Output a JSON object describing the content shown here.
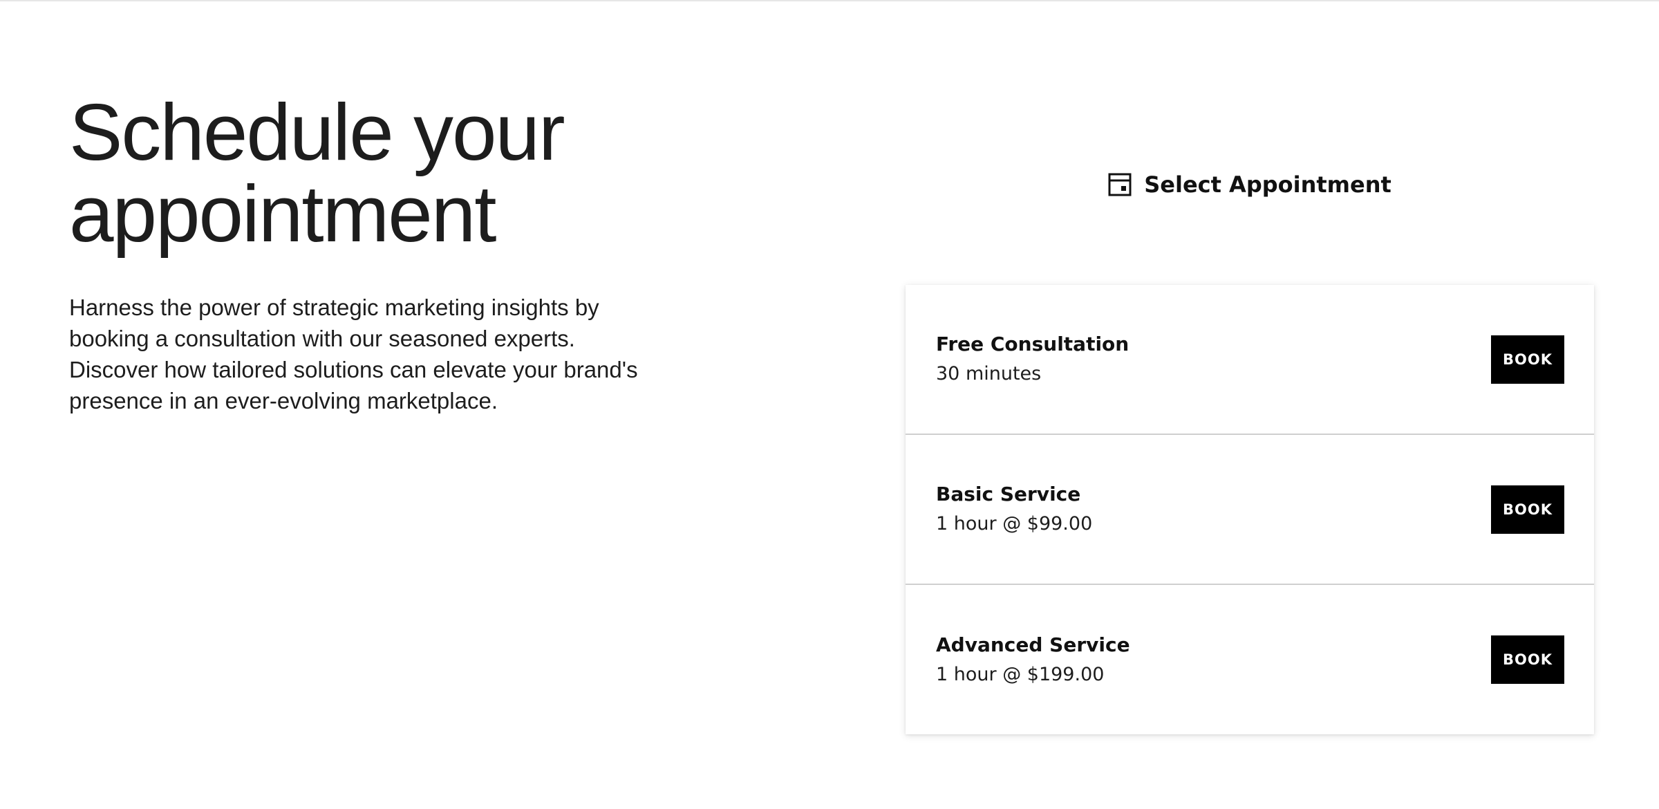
{
  "hero": {
    "title_line1": "Schedule your",
    "title_line2": "appointment",
    "description": "Harness the power of strategic marketing insights by booking a consultation with our seasoned experts. Discover how tailored solutions can elevate your brand's presence in an ever-evolving marketplace."
  },
  "booking": {
    "header_icon": "calendar-icon",
    "title": "Select Appointment",
    "services": [
      {
        "name": "Free Consultation",
        "detail": "30 minutes",
        "button_label": "BOOK"
      },
      {
        "name": "Basic Service",
        "detail": "1 hour @ $99.00",
        "button_label": "BOOK"
      },
      {
        "name": "Advanced Service",
        "detail": "1 hour @ $199.00",
        "button_label": "BOOK"
      }
    ]
  },
  "colors": {
    "text": "#1d1d1d",
    "button_bg": "#000000",
    "button_text": "#ffffff",
    "divider": "#cfcfcf"
  }
}
